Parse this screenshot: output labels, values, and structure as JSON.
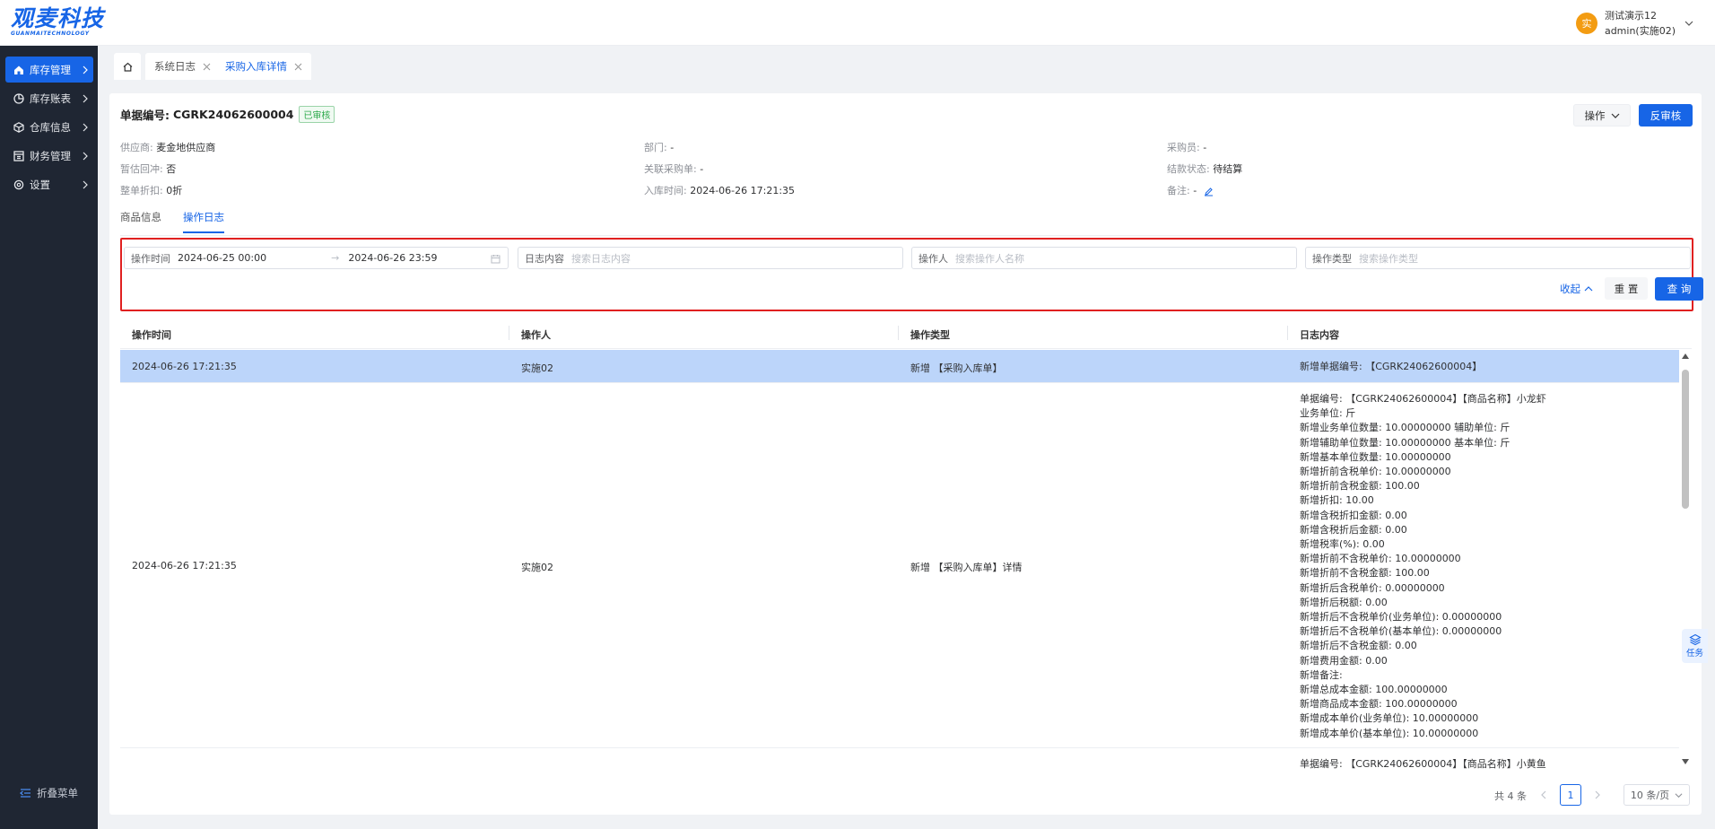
{
  "brand": {
    "name": "观麦科技",
    "tagline": "GUANMAITECHNOLOGY"
  },
  "user": {
    "avatar_text": "实",
    "name": "测试演示12",
    "account": "admin(实施02)"
  },
  "sidebar": {
    "items": [
      {
        "label": "库存管理",
        "icon": "house-icon",
        "active": true
      },
      {
        "label": "库存账表",
        "icon": "pie-chart-icon",
        "active": false
      },
      {
        "label": "仓库信息",
        "icon": "cube-icon",
        "active": false
      },
      {
        "label": "财务管理",
        "icon": "ledger-icon",
        "active": false
      },
      {
        "label": "设置",
        "icon": "gear-icon",
        "active": false
      }
    ],
    "collapse_label": "折叠菜单"
  },
  "tabs": [
    {
      "label": "系统日志",
      "active": false
    },
    {
      "label": "采购入库详情",
      "active": true
    }
  ],
  "document": {
    "number_label": "单据编号:",
    "number": "CGRK24062600004",
    "status": "已审核",
    "actions": {
      "operate": "操作",
      "reverse_audit": "反审核"
    },
    "fields": {
      "supplier": {
        "label": "供应商:",
        "value": "麦金地供应商"
      },
      "department": {
        "label": "部门:",
        "value": "-"
      },
      "buyer": {
        "label": "采购员:",
        "value": "-"
      },
      "offset": {
        "label": "暂估回冲:",
        "value": "否"
      },
      "linked_po": {
        "label": "关联采购单:",
        "value": "-"
      },
      "settle_status": {
        "label": "结款状态:",
        "value": "待结算"
      },
      "discount": {
        "label": "整单折扣:",
        "value": "0折"
      },
      "inbound_time": {
        "label": "入库时间:",
        "value": "2024-06-26 17:21:35"
      },
      "remark": {
        "label": "备注:",
        "value": "-"
      }
    }
  },
  "subtabs": [
    {
      "label": "商品信息",
      "active": false
    },
    {
      "label": "操作日志",
      "active": true
    }
  ],
  "filters": {
    "time": {
      "label": "操作时间",
      "start": "2024-06-25 00:00",
      "separator": "→",
      "end": "2024-06-26 23:59"
    },
    "content": {
      "label": "日志内容",
      "placeholder": "搜索日志内容"
    },
    "operator": {
      "label": "操作人",
      "placeholder": "搜索操作人名称"
    },
    "type": {
      "label": "操作类型",
      "placeholder": "搜索操作类型"
    },
    "collapse_label": "收起",
    "reset_label": "重 置",
    "query_label": "查 询"
  },
  "table": {
    "columns": [
      "操作时间",
      "操作人",
      "操作类型",
      "日志内容"
    ],
    "rows": [
      {
        "time": "2024-06-26 17:21:35",
        "operator": "实施02",
        "type": "新增 【采购入库单】",
        "log": [
          "新增单据编号: 【CGRK24062600004】"
        ]
      },
      {
        "time": "2024-06-26 17:21:35",
        "operator": "实施02",
        "type": "新增 【采购入库单】详情",
        "log": [
          "单据编号: 【CGRK24062600004】【商品名称】小龙虾",
          "业务单位: 斤",
          "新增业务单位数量: 10.00000000 辅助单位: 斤",
          "新增辅助单位数量: 10.00000000 基本单位: 斤",
          "新增基本单位数量: 10.00000000",
          "新增折前含税单价: 10.00000000",
          "新增折前含税金额: 100.00",
          "新增折扣: 10.00",
          "新增含税折扣金额: 0.00",
          "新增含税折后金额: 0.00",
          "新增税率(%): 0.00",
          "新增折前不含税单价: 10.00000000",
          "新增折前不含税金额: 100.00",
          "新增折后含税单价: 0.00000000",
          "新增折后税额: 0.00",
          "新增折后不含税单价(业务单位): 0.00000000",
          "新增折后不含税单价(基本单位): 0.00000000",
          "新增折后不含税金额: 0.00",
          "新增费用金额: 0.00",
          "新增备注:",
          "新增总成本金额: 100.00000000",
          "新增商品成本金额: 100.00000000",
          "新增成本单价(业务单位): 10.00000000",
          "新增成本单价(基本单位): 10.00000000"
        ]
      },
      {
        "time": "",
        "operator": "",
        "type": "",
        "log": [
          "单据编号: 【CGRK24062600004】【商品名称】小黄鱼"
        ]
      }
    ]
  },
  "pagination": {
    "total": "共 4 条",
    "current": "1",
    "page_size": "10 条/页"
  },
  "float_task": {
    "label": "任务"
  },
  "colors": {
    "primary": "#1765e6",
    "sidebar": "#1f2633",
    "selected_row": "#bcd5fa",
    "highlight_border": "#e02020"
  }
}
